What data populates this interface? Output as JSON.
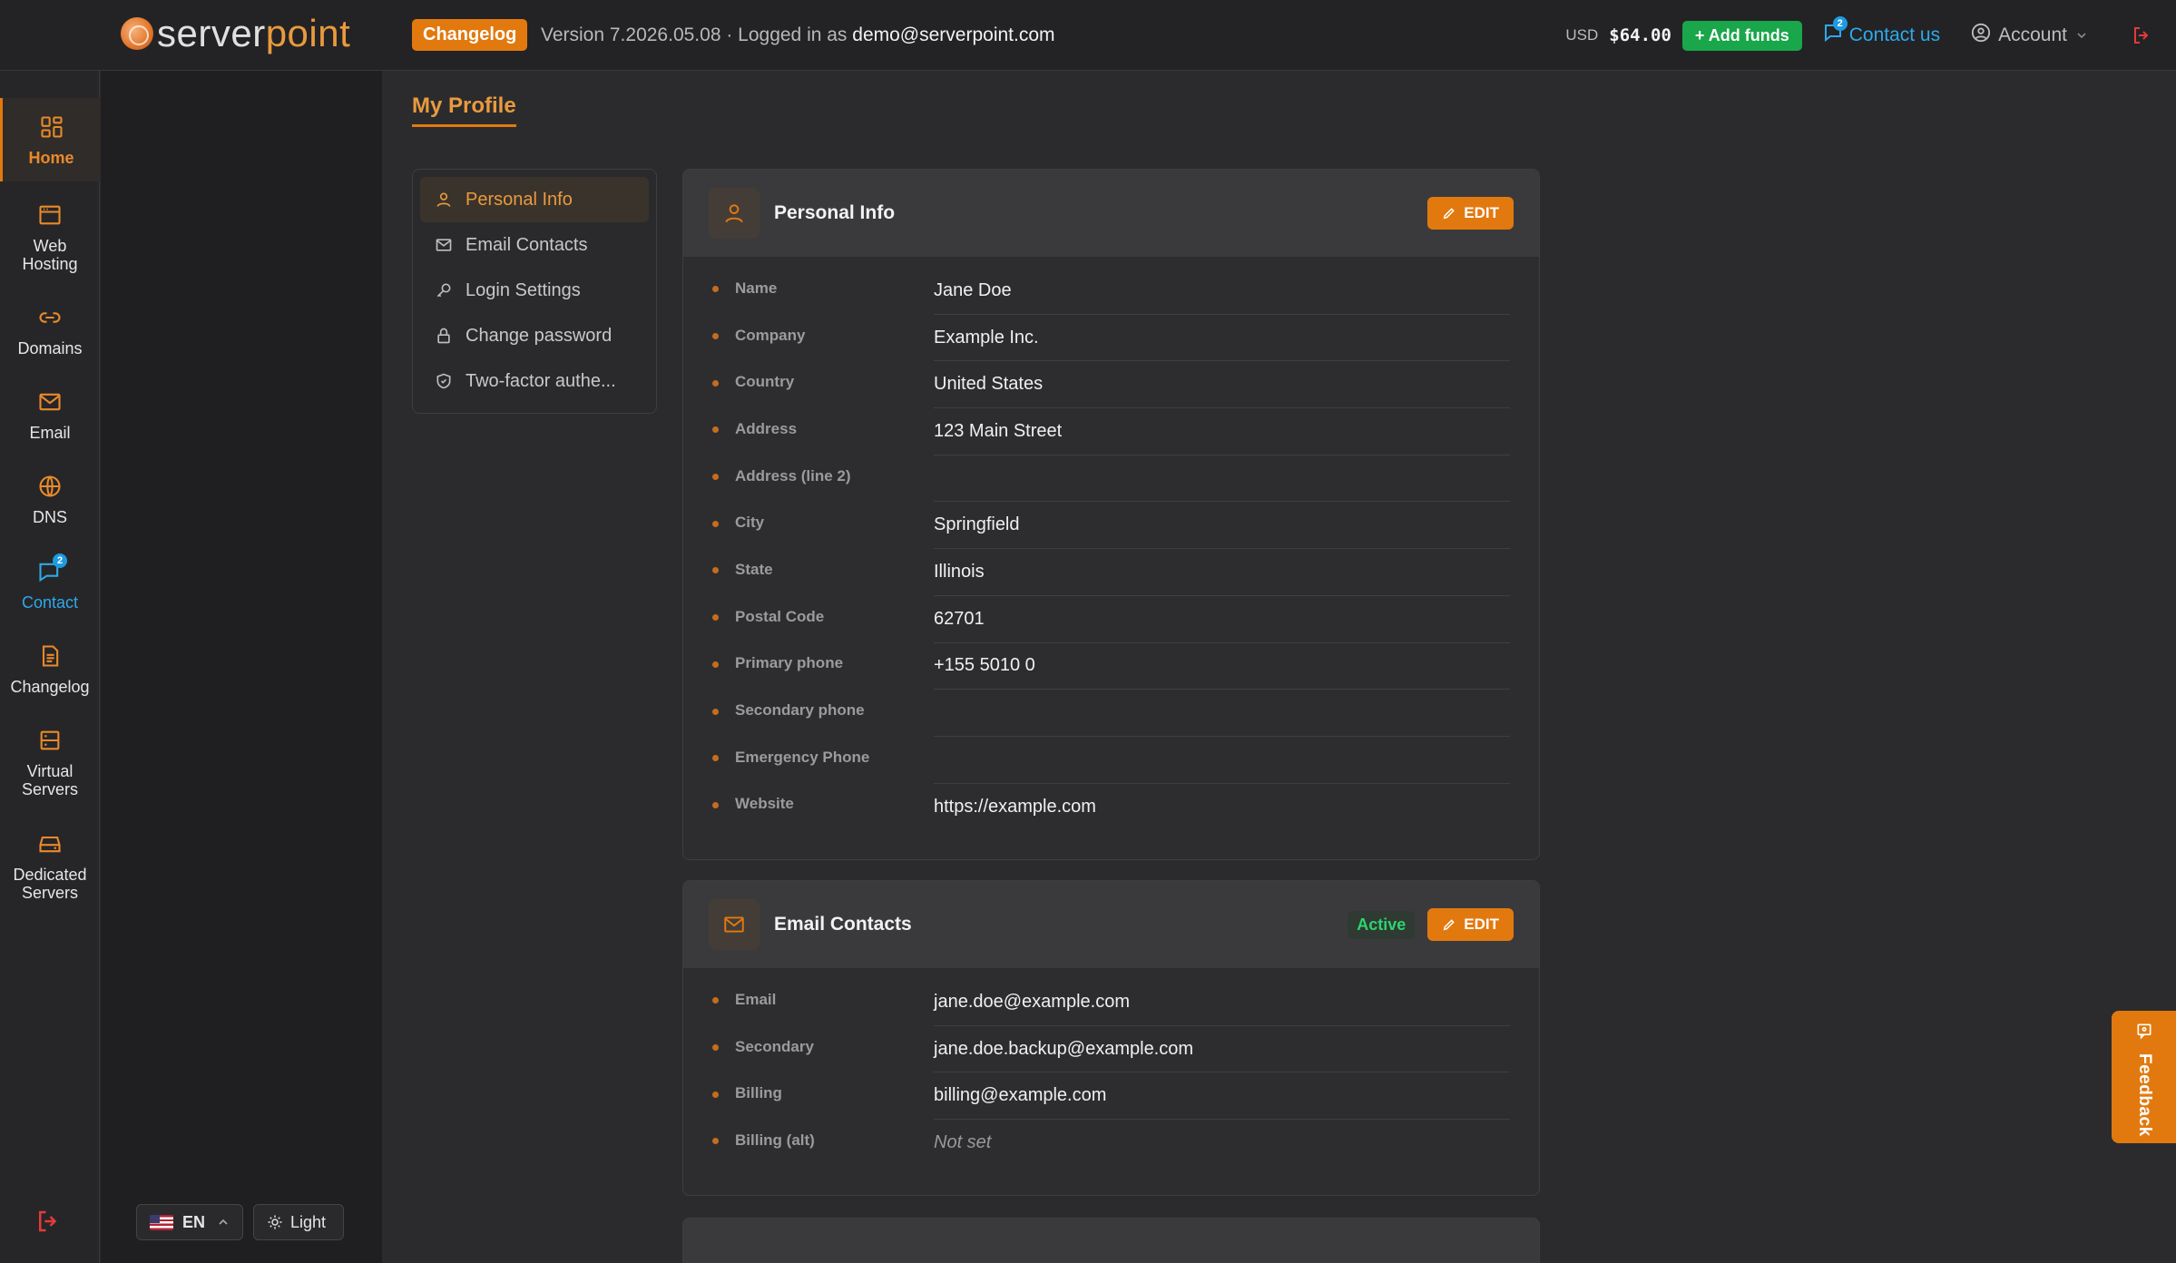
{
  "header": {
    "logo_part1": "server",
    "logo_part2": "point",
    "changelog_label": "Changelog",
    "version_prefix": "Version 7.2026.05.08 · Logged in as",
    "user_email": "demo@serverpoint.com",
    "currency": "USD",
    "balance": "$64.00",
    "add_funds_label": "+ Add funds",
    "contact_label": "Contact us",
    "contact_badge": "2",
    "account_label": "Account"
  },
  "sidebar": {
    "items": [
      {
        "label": "Home",
        "icon": "grid-icon"
      },
      {
        "label": "Web Hosting",
        "icon": "browser-icon"
      },
      {
        "label": "Domains",
        "icon": "link-icon"
      },
      {
        "label": "Email",
        "icon": "mail-icon"
      },
      {
        "label": "DNS",
        "icon": "globe-icon"
      },
      {
        "label": "Contact",
        "icon": "chat-icon",
        "badge": "2"
      },
      {
        "label": "Changelog",
        "icon": "document-icon"
      },
      {
        "label": "Virtual Servers",
        "icon": "server-icon"
      },
      {
        "label": "Dedicated Servers",
        "icon": "harddrive-icon"
      }
    ]
  },
  "footer_controls": {
    "language": "EN",
    "theme": "Light"
  },
  "page": {
    "title": "My Profile"
  },
  "subnav": {
    "items": [
      {
        "label": "Personal Info",
        "icon": "user-icon"
      },
      {
        "label": "Email Contacts",
        "icon": "mail-icon"
      },
      {
        "label": "Login Settings",
        "icon": "key-icon"
      },
      {
        "label": "Change password",
        "icon": "lock-icon"
      },
      {
        "label": "Two-factor authe...",
        "icon": "shield-icon"
      }
    ]
  },
  "personal_info": {
    "title": "Personal Info",
    "edit_label": "EDIT",
    "fields": [
      {
        "label": "Name",
        "value": "Jane Doe"
      },
      {
        "label": "Company",
        "value": "Example Inc."
      },
      {
        "label": "Country",
        "value": "United States"
      },
      {
        "label": "Address",
        "value": "123 Main Street"
      },
      {
        "label": "Address (line 2)",
        "value": ""
      },
      {
        "label": "City",
        "value": "Springfield"
      },
      {
        "label": "State",
        "value": "Illinois"
      },
      {
        "label": "Postal Code",
        "value": "62701"
      },
      {
        "label": "Primary phone",
        "value": "+155 5010 0"
      },
      {
        "label": "Secondary phone",
        "value": ""
      },
      {
        "label": "Emergency Phone",
        "value": ""
      },
      {
        "label": "Website",
        "value": "https://example.com"
      }
    ]
  },
  "email_contacts": {
    "title": "Email Contacts",
    "status": "Active",
    "edit_label": "EDIT",
    "fields": [
      {
        "label": "Email",
        "value": "jane.doe@example.com"
      },
      {
        "label": "Secondary",
        "value": "jane.doe.backup@example.com"
      },
      {
        "label": "Billing",
        "value": "billing@example.com"
      },
      {
        "label": "Billing (alt)",
        "value": "Not set"
      }
    ]
  },
  "feedback_label": "Feedback",
  "colors": {
    "accent": "#e2790f",
    "success": "#1aa64a",
    "link": "#2ea9ea",
    "danger": "#e23b3b"
  }
}
